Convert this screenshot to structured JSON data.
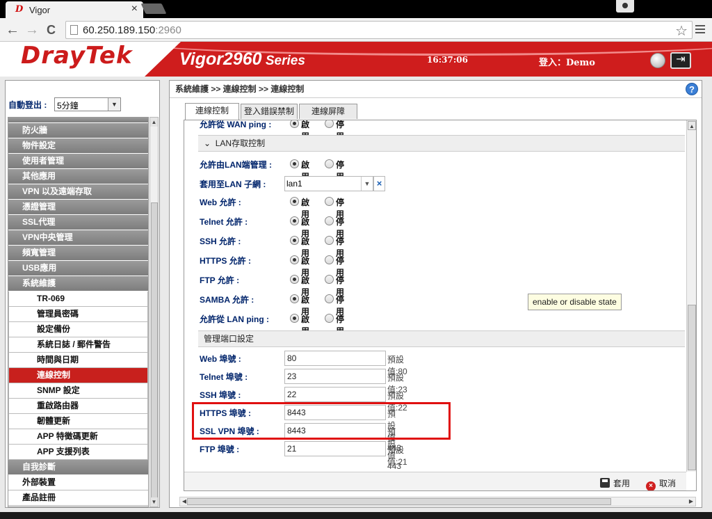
{
  "browser": {
    "tab_title": "Vigor",
    "tab_close": "×",
    "url_host": "60.250.189.150",
    "url_port": ":2960",
    "star": "☆",
    "back": "←",
    "forward": "→",
    "reload": "C"
  },
  "banner": {
    "logo": "DrayTek",
    "product": "Vigor2960",
    "series": " Series",
    "clock": "16:37:06",
    "login": "登入：Demo"
  },
  "sidebar": {
    "autologout_label": "自動登出 :",
    "autologout_value": "5分鐘",
    "items": [
      {
        "label": "",
        "type": "partial"
      },
      {
        "label": "防火牆",
        "type": "main"
      },
      {
        "label": "物件設定",
        "type": "main"
      },
      {
        "label": "使用者管理",
        "type": "main"
      },
      {
        "label": "其他應用",
        "type": "main"
      },
      {
        "label": "VPN 以及遠端存取",
        "type": "main"
      },
      {
        "label": "憑證管理",
        "type": "main"
      },
      {
        "label": "SSL代理",
        "type": "main"
      },
      {
        "label": "VPN中央管理",
        "type": "main"
      },
      {
        "label": "頻寬管理",
        "type": "main"
      },
      {
        "label": "USB應用",
        "type": "main"
      },
      {
        "label": "系統維護",
        "type": "main"
      },
      {
        "label": "TR-069",
        "type": "sub"
      },
      {
        "label": "管理員密碼",
        "type": "sub"
      },
      {
        "label": "設定備份",
        "type": "sub"
      },
      {
        "label": "系統日誌 / 郵件警告",
        "type": "sub"
      },
      {
        "label": "時間與日期",
        "type": "sub"
      },
      {
        "label": "連線控制",
        "type": "sub",
        "active": true
      },
      {
        "label": "SNMP 設定",
        "type": "sub"
      },
      {
        "label": "重啟路由器",
        "type": "sub"
      },
      {
        "label": "韌體更新",
        "type": "sub"
      },
      {
        "label": "APP 特徵碼更新",
        "type": "sub"
      },
      {
        "label": "APP 支援列表",
        "type": "sub"
      },
      {
        "label": "自我診斷",
        "type": "main"
      },
      {
        "label": "外部裝置",
        "type": "plain"
      },
      {
        "label": "產品註冊",
        "type": "plain"
      }
    ]
  },
  "main": {
    "breadcrumb": "系統維護 >> 連線控制 >> 連線控制",
    "help": "?",
    "tabs": [
      "連線控制",
      "登入錯誤禁制",
      "連線屏障"
    ],
    "enable": "啟用",
    "disable": "停用",
    "wan_ping_label": "允許從 WAN ping :",
    "lan_section": "LAN存取控制",
    "lan_rows": [
      {
        "label": "允許由LAN端管理 :"
      },
      {
        "label": "Web 允許 :"
      },
      {
        "label": "Telnet 允許 :"
      },
      {
        "label": "SSH 允許 :"
      },
      {
        "label": "HTTPS 允許 :"
      },
      {
        "label": "FTP 允許 :"
      },
      {
        "label": "SAMBA 允許 :"
      },
      {
        "label": "允許從 LAN ping :"
      }
    ],
    "subnet_label": "套用至LAN 子網 :",
    "subnet_value": "lan1",
    "subnet_clear": "×",
    "port_section": "管理端口設定",
    "ports": [
      {
        "label": "Web 埠號 :",
        "value": "80",
        "default": "預設值:80"
      },
      {
        "label": "Telnet 埠號 :",
        "value": "23",
        "default": "預設值:23"
      },
      {
        "label": "SSH 埠號 :",
        "value": "22",
        "default": "預設值:22"
      },
      {
        "label": "HTTPS 埠號 :",
        "value": "8443",
        "default": "預設值 443"
      },
      {
        "label": "SSL VPN 埠號 :",
        "value": "8443",
        "default": "預設值 443"
      },
      {
        "label": "FTP 埠號 :",
        "value": "21",
        "default": "預設值:21"
      }
    ],
    "tooltip": "enable or disable state",
    "apply": "套用",
    "cancel": "取消"
  }
}
